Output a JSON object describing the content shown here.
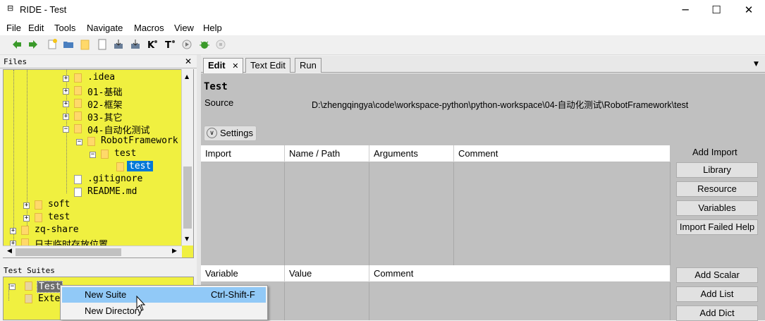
{
  "window": {
    "title": "RIDE - Test",
    "minimize": "─",
    "maximize": "☐",
    "close": "✕"
  },
  "menubar": [
    "File",
    "Edit",
    "Tools",
    "Navigate",
    "Macros",
    "View",
    "Help"
  ],
  "files": {
    "header": "Files",
    "close_label": "✕",
    "tree": [
      {
        "label": ".idea",
        "type": "folder",
        "expander": "+"
      },
      {
        "label": "01-基础",
        "type": "folder",
        "expander": "+"
      },
      {
        "label": "02-框架",
        "type": "folder",
        "expander": "+"
      },
      {
        "label": "03-其它",
        "type": "folder",
        "expander": "+"
      },
      {
        "label": "04-自动化测试",
        "type": "folder",
        "expander": "−"
      },
      {
        "label": "RobotFramework",
        "type": "folder",
        "expander": "−"
      },
      {
        "label": "test",
        "type": "folder",
        "expander": "−"
      },
      {
        "label": "test",
        "type": "folder",
        "expander": "",
        "selected": true
      },
      {
        "label": ".gitignore",
        "type": "file",
        "expander": ""
      },
      {
        "label": "README.md",
        "type": "file",
        "expander": ""
      },
      {
        "label": "soft",
        "type": "folder",
        "expander": "+"
      },
      {
        "label": "test",
        "type": "folder",
        "expander": "+"
      },
      {
        "label": "zq-share",
        "type": "folder",
        "expander": "+"
      },
      {
        "label": "日志临时存放位置",
        "type": "folder",
        "expander": "+"
      }
    ]
  },
  "suites": {
    "header": "Test Suites",
    "items": [
      {
        "label": "Test",
        "selected": true
      },
      {
        "label": "Exte"
      }
    ]
  },
  "tabs": [
    {
      "label": "Edit",
      "active": true,
      "close": "✕"
    },
    {
      "label": "Text Edit"
    },
    {
      "label": "Run"
    }
  ],
  "editor": {
    "suite_name": "Test",
    "source_label": "Source",
    "source_path": "D:\\zhengqingya\\code\\workspace-python\\python-workspace\\04-自动化测试\\RobotFramework\\test",
    "settings_label": "Settings",
    "import_headers": [
      "Import",
      "Name / Path",
      "Arguments",
      "Comment"
    ],
    "variable_headers": [
      "Variable",
      "Value",
      "Comment"
    ],
    "add_import_label": "Add Import",
    "import_buttons": [
      "Library",
      "Resource",
      "Variables",
      "Import Failed Help"
    ],
    "variable_buttons": [
      "Add Scalar",
      "Add List",
      "Add Dict"
    ]
  },
  "context_menu": {
    "items": [
      {
        "label": "New Suite",
        "shortcut": "Ctrl-Shift-F",
        "highlighted": true
      },
      {
        "label": "New Directory",
        "shortcut": ""
      }
    ]
  },
  "colors": {
    "tree_background": "#f0f040",
    "selection": "#0078d7",
    "menu_highlight": "#91c9f7"
  }
}
